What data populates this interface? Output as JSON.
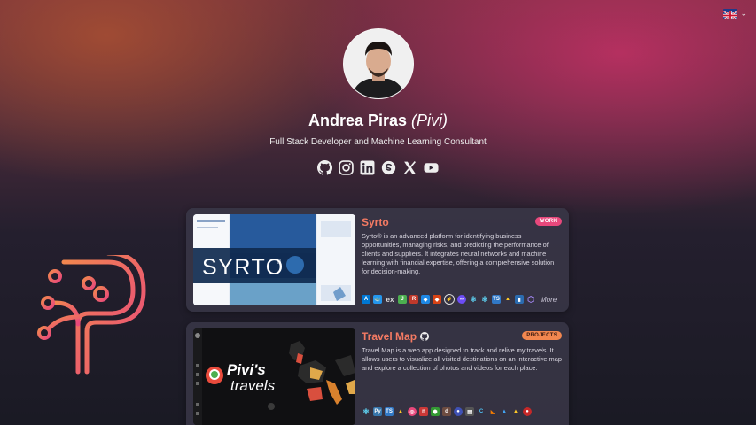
{
  "language": {
    "icon": "uk-flag-icon",
    "chevron": "chevron-down-icon"
  },
  "profile": {
    "name": "Andrea Piras",
    "nickname": "(Pivi)",
    "subtitle": "Full Stack Developer and Machine Learning Consultant"
  },
  "socials": [
    "github-icon",
    "instagram-icon",
    "linkedin-icon",
    "skype-icon",
    "x-icon",
    "youtube-icon"
  ],
  "projects": [
    {
      "title": "Syrto",
      "badge": "WORK",
      "thumb_text": "SYRTO",
      "thumb_reg": "®",
      "description": "Syrto® is an advanced platform for identifying business opportunities, managing risks, and predicting the performance of clients and suppliers. It integrates neural networks and machine learning with financial expertise, offering a comprehensive solution for decision-making.",
      "more": "More"
    },
    {
      "title": "Travel Map",
      "badge": "PROJECTS",
      "thumb_line1": "Pivi's",
      "thumb_line2": "travels",
      "description": "Travel Map is a web app designed to track and relive my travels. It allows users to visualize all visited destinations on an interactive map and explore a collection of photos and videos for each place."
    }
  ],
  "colors": {
    "accent": "#f47a63",
    "work_badge": "#e8487c",
    "projects_badge": "#f2874f"
  }
}
